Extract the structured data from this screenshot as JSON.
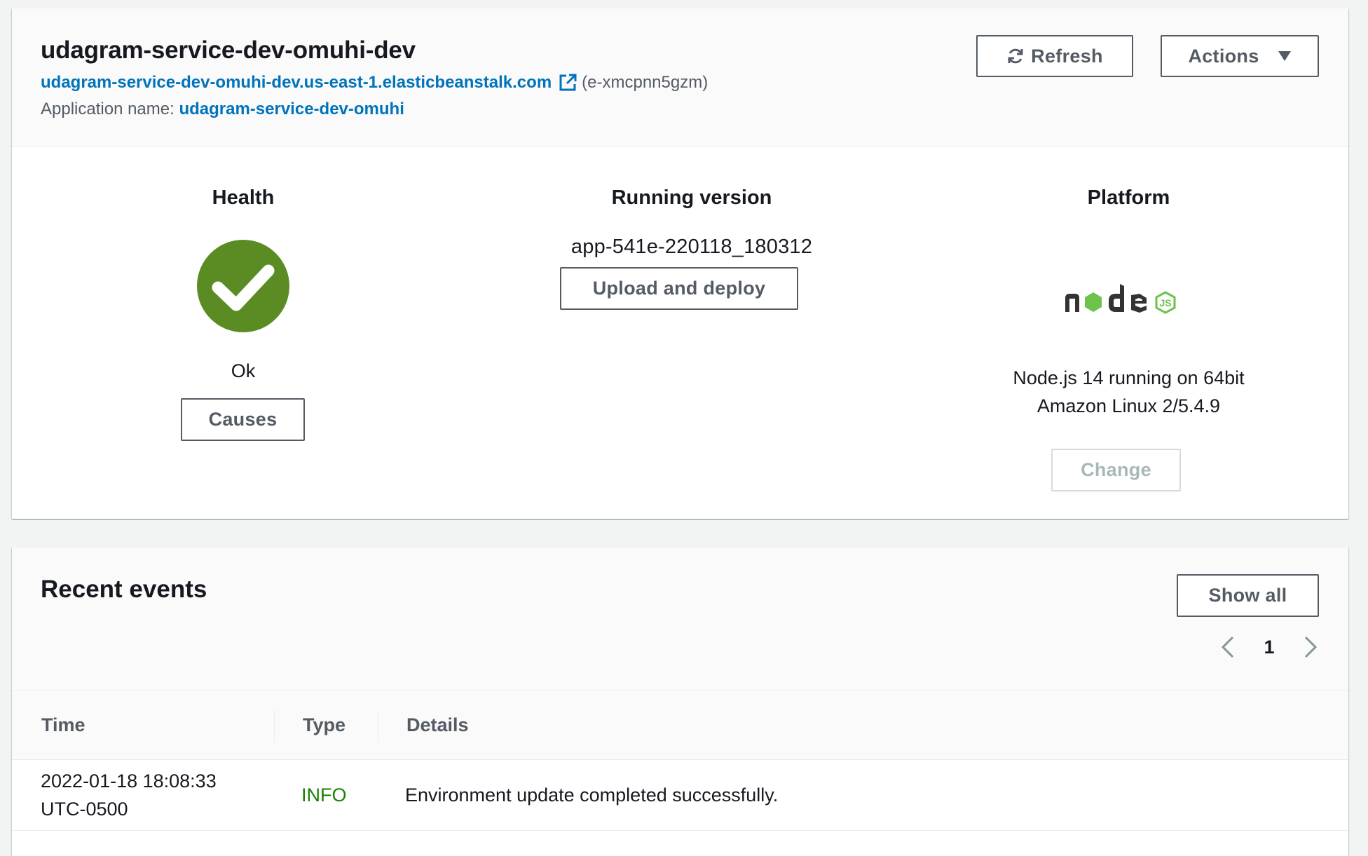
{
  "environment": {
    "name": "udagram-service-dev-omuhi-dev",
    "url": "udagram-service-dev-omuhi-dev.us-east-1.elasticbeanstalk.com",
    "env_id": "(e-xmcpnn5gzm)",
    "app_label": "Application name:",
    "app_name": "udagram-service-dev-omuhi"
  },
  "toolbar": {
    "refresh_label": "Refresh",
    "actions_label": "Actions"
  },
  "health": {
    "title": "Health",
    "status": "Ok",
    "causes_label": "Causes",
    "color": "#5b8c24"
  },
  "version": {
    "title": "Running version",
    "value": "app-541e-220118_180312",
    "upload_label": "Upload and deploy"
  },
  "platform": {
    "title": "Platform",
    "logo": "node-js-logo",
    "line1": "Node.js 14 running on 64bit",
    "line2": "Amazon Linux 2/5.4.9",
    "change_label": "Change"
  },
  "events": {
    "title": "Recent events",
    "show_all_label": "Show all",
    "page": "1",
    "columns": [
      "Time",
      "Type",
      "Details"
    ],
    "rows": [
      {
        "time_line1": "2022-01-18 18:08:33",
        "time_line2": "UTC-0500",
        "type": "INFO",
        "details": "Environment update completed successfully."
      }
    ]
  },
  "colors": {
    "link": "#0073bb",
    "info": "#1d8102",
    "button_border": "#545b64"
  }
}
